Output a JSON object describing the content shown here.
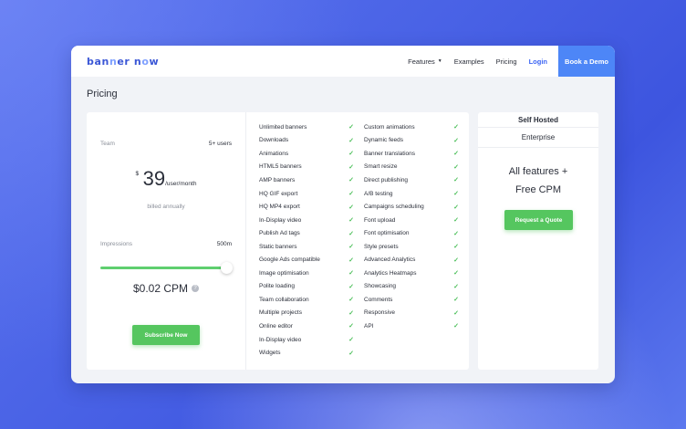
{
  "nav": {
    "logo_part1": "ban",
    "logo_accent": "n",
    "logo_part2": "er n",
    "logo_accent2": "o",
    "logo_part3": "w",
    "features": "Features",
    "examples": "Examples",
    "pricing": "Pricing",
    "login": "Login",
    "book_demo": "Book a Demo"
  },
  "page_title": "Pricing",
  "plan": {
    "team_label": "Team",
    "team_value": "5+ users",
    "currency": "$",
    "price": "39",
    "per": "/user/month",
    "billed": "billed annually",
    "impressions_label": "Impressions",
    "impressions_value": "500m",
    "slider_fraction": 1.0,
    "cpm": "$0.02 CPM",
    "help": "?",
    "subscribe": "Subscribe Now"
  },
  "features_col1": [
    "Unlimited banners",
    "Downloads",
    "Animations",
    "HTML5 banners",
    "AMP banners",
    "HQ GIF export",
    "HQ MP4 export",
    "In-Display video",
    "Publish Ad tags",
    "Static banners",
    "Google Ads compatible",
    "Image optimisation",
    "Polite loading",
    "Team collaboration",
    "Multiple projects",
    "Online editor",
    "In-Display video",
    "Widgets"
  ],
  "features_col2": [
    "Custom animations",
    "Dynamic feeds",
    "Banner translations",
    "Smart resize",
    "Direct publishing",
    "A/B testing",
    "Campaigns scheduling",
    "Font upload",
    "Font optimisation",
    "Style presets",
    "Advanced Analytics",
    "Analytics Heatmaps",
    "Showcasing",
    "Comments",
    "Responsive",
    "API"
  ],
  "check_glyph": "✓",
  "enterprise": {
    "self_hosted": "Self Hosted",
    "title": "Enterprise",
    "all_features_line1": "All features +",
    "all_features_line2": "Free CPM",
    "request_quote": "Request a Quote"
  },
  "colors": {
    "accent": "#4d86f7",
    "green": "#55c65f",
    "background": "#4a63e6"
  }
}
